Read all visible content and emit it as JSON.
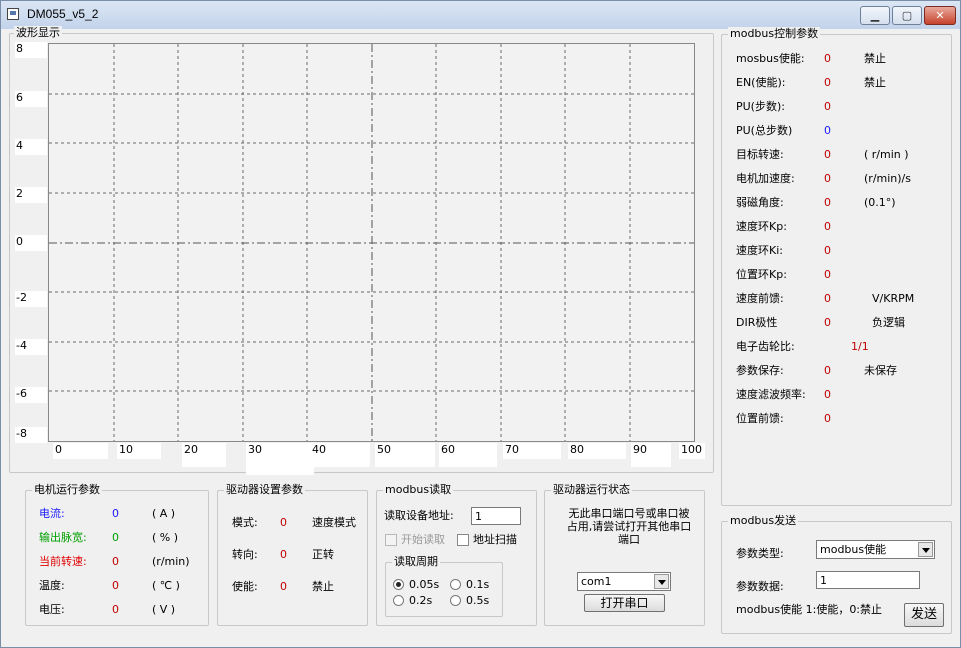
{
  "window": {
    "title": "DM055_v5_2",
    "min": "▁",
    "max": "▢",
    "close": "✕"
  },
  "waveform": {
    "title": "波形显示",
    "y_ticks": [
      "8",
      "6",
      "4",
      "2",
      "0",
      "-2",
      "-4",
      "-6",
      "-8"
    ],
    "x_ticks": [
      "0",
      "10",
      "20",
      "30",
      "40",
      "50",
      "60",
      "70",
      "80",
      "90",
      "100"
    ]
  },
  "modbus_ctrl": {
    "title": "modbus控制参数",
    "rows": [
      {
        "label": "mosbus使能:",
        "value": "0",
        "unit": "禁止"
      },
      {
        "label": "EN(使能):",
        "value": "0",
        "unit": "禁止"
      },
      {
        "label": "PU(步数):",
        "value": "0",
        "unit": ""
      },
      {
        "label": "PU(总步数)",
        "value": "0",
        "unit": ""
      },
      {
        "label": "目标转速:",
        "value": "0",
        "unit": "( r/min )"
      },
      {
        "label": "电机加速度:",
        "value": "0",
        "unit": "(r/min)/s"
      },
      {
        "label": "弱磁角度:",
        "value": "0",
        "unit": "(0.1°)"
      },
      {
        "label": "速度环Kp:",
        "value": "0",
        "unit": ""
      },
      {
        "label": "速度环Ki:",
        "value": "0",
        "unit": ""
      },
      {
        "label": "位置环Kp:",
        "value": "0",
        "unit": ""
      },
      {
        "label": "速度前馈:",
        "value": "0",
        "unit": "V/KRPM"
      },
      {
        "label": "DIR极性",
        "value": "0",
        "unit": "负逻辑"
      },
      {
        "label": "电子齿轮比:",
        "value": "1/1",
        "unit": ""
      },
      {
        "label": "参数保存:",
        "value": "0",
        "unit": "未保存"
      },
      {
        "label": "速度滤波频率:",
        "value": "0",
        "unit": ""
      },
      {
        "label": "位置前馈:",
        "value": "0",
        "unit": ""
      }
    ]
  },
  "motor_params": {
    "title": "电机运行参数",
    "rows": [
      {
        "label": "电流:",
        "value": "0",
        "unit": "( A )"
      },
      {
        "label": "输出脉宽:",
        "value": "0",
        "unit": "( % )"
      },
      {
        "label": "当前转速:",
        "value": "0",
        "unit": "(r/min)"
      },
      {
        "label": "温度:",
        "value": "0",
        "unit": "( ℃ )"
      },
      {
        "label": "电压:",
        "value": "0",
        "unit": "( V )"
      }
    ]
  },
  "driver_settings": {
    "title": "驱动器设置参数",
    "rows": [
      {
        "label": "模式:",
        "value": "0",
        "unit": "速度模式"
      },
      {
        "label": "转向:",
        "value": "0",
        "unit": "正转"
      },
      {
        "label": "使能:",
        "value": "0",
        "unit": "禁止"
      }
    ]
  },
  "modbus_read": {
    "title": "modbus读取",
    "addr_label": "读取设备地址:",
    "addr_value": "1",
    "start_read": "开始读取",
    "addr_scan": "地址扫描",
    "period_title": "读取周期",
    "periods": [
      "0.05s",
      "0.1s",
      "0.2s",
      "0.5s"
    ]
  },
  "driver_status": {
    "title": "驱动器运行状态",
    "message_line1": "无此串口端口号或串口被",
    "message_line2": "占用,请尝试打开其他串口",
    "message_line3": "端口",
    "port": "com1",
    "open_button": "打开串口"
  },
  "modbus_send": {
    "title": "modbus发送",
    "type_label": "参数类型:",
    "type_value": "modbus使能",
    "data_label": "参数数据:",
    "data_value": "1",
    "hint": "modbus使能 1:使能，0:禁止",
    "send_button": "发送"
  }
}
